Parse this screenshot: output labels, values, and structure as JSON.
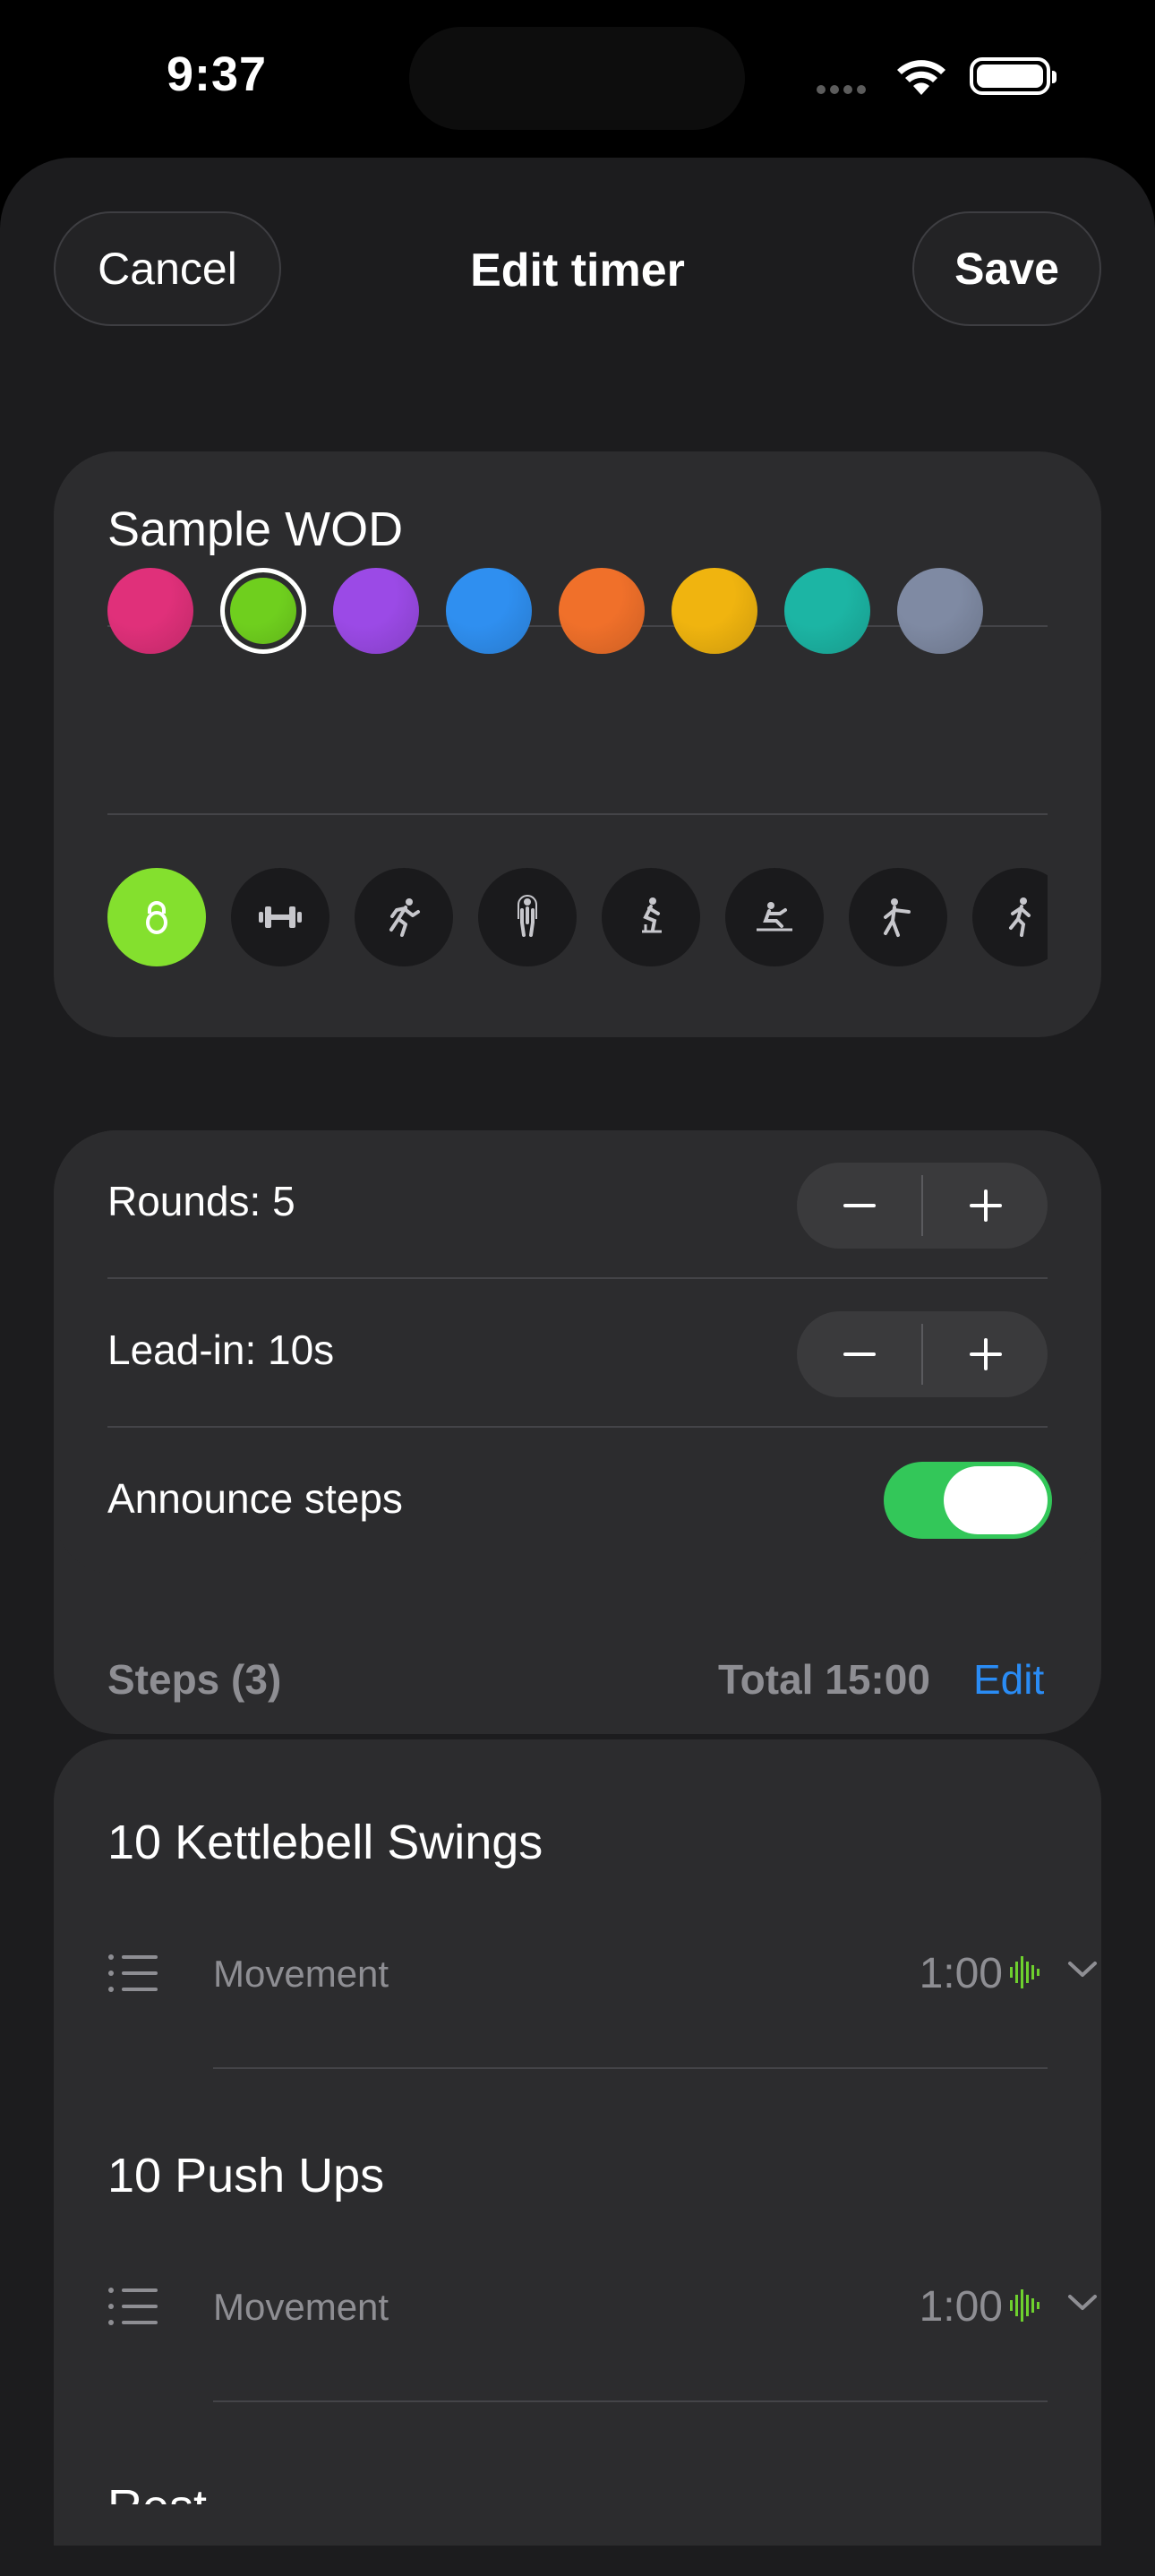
{
  "status": {
    "time": "9:37"
  },
  "nav": {
    "cancel": "Cancel",
    "title": "Edit timer",
    "save": "Save"
  },
  "timer": {
    "name": "Sample WOD",
    "colors": [
      "#e0307a",
      "#6fcf1e",
      "#9b4ae6",
      "#2f8ff0",
      "#f0702a",
      "#f0b40f",
      "#1cb5a4",
      "#7f8aa3"
    ],
    "selected_color_index": 1,
    "icons": [
      "kettlebell-icon",
      "dumbbell-icon",
      "running-icon",
      "jump-rope-icon",
      "cycling-icon",
      "rowing-icon",
      "boxing-icon",
      "climbing-icon"
    ],
    "selected_icon_index": 0
  },
  "settings": {
    "rounds_label": "Rounds: 5",
    "leadin_label": "Lead-in: 10s",
    "announce_label": "Announce steps",
    "announce_on": true
  },
  "steps_header": {
    "title": "Steps (3)",
    "total": "Total 15:00",
    "edit": "Edit"
  },
  "steps": [
    {
      "title": "10 Kettlebell Swings",
      "type": "Movement",
      "duration": "1:00"
    },
    {
      "title": "10 Push Ups",
      "type": "Movement",
      "duration": "1:00"
    },
    {
      "title": "Rest"
    }
  ]
}
